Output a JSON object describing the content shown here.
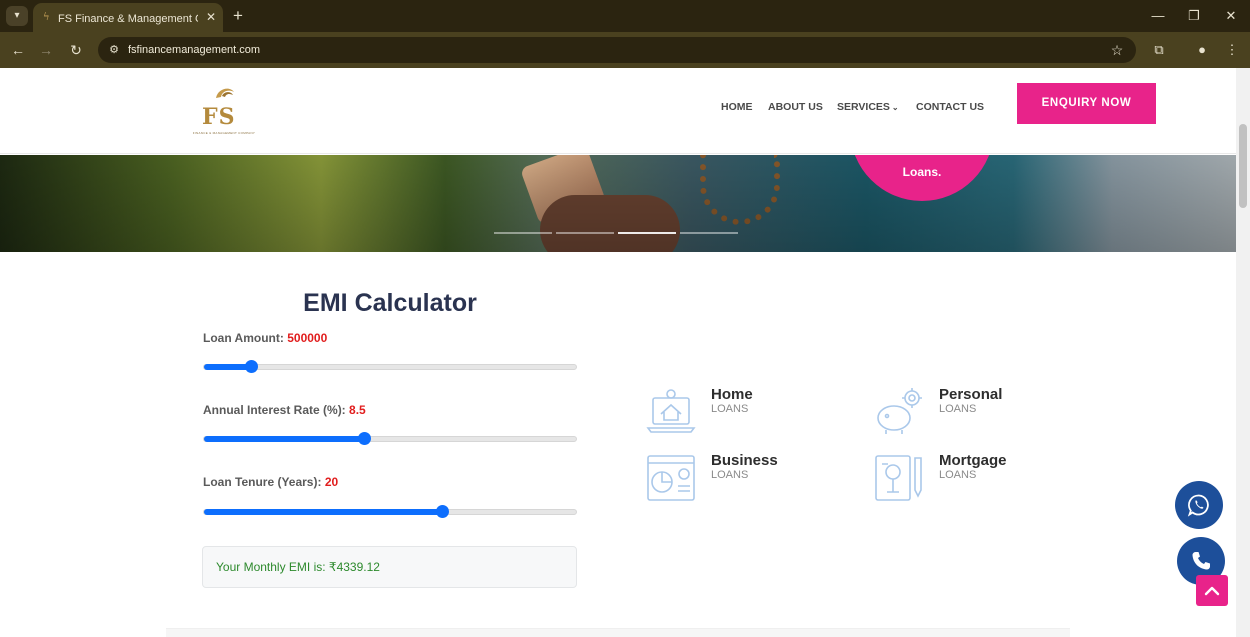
{
  "browser": {
    "tab_title": "FS Finance & Management Com",
    "url": "fsfinancemanagement.com"
  },
  "header": {
    "logo_text": "FS",
    "logo_subtext": "FINANCE & MANAGEMENT COMPANY",
    "nav": [
      {
        "label": "HOME"
      },
      {
        "label": "ABOUT US"
      },
      {
        "label": "SERVICES",
        "has_dropdown": true
      },
      {
        "label": "CONTACT US"
      }
    ],
    "cta_label": "ENQUIRY NOW"
  },
  "hero": {
    "circle_text": "Loans.",
    "slides": 4,
    "active_slide": 3
  },
  "emi": {
    "title": "EMI Calculator",
    "loan_amount": {
      "label": "Loan Amount:",
      "value": "500000",
      "fraction": 0.125
    },
    "interest_rate": {
      "label": "Annual Interest Rate (%):",
      "value": "8.5",
      "fraction": 0.43
    },
    "tenure": {
      "label": "Loan Tenure (Years):",
      "value": "20",
      "fraction": 0.64
    },
    "result_text": "Your Monthly EMI is: ₹4339.12"
  },
  "loans": [
    {
      "title": "Home",
      "subtitle": "LOANS",
      "icon": "laptop-house-icon"
    },
    {
      "title": "Personal",
      "subtitle": "LOANS",
      "icon": "piggy-bank-icon"
    },
    {
      "title": "Business",
      "subtitle": "LOANS",
      "icon": "chart-report-icon"
    },
    {
      "title": "Mortgage",
      "subtitle": "LOANS",
      "icon": "document-pen-icon"
    }
  ],
  "colors": {
    "accent": "#e8238a",
    "slider": "#0d6efd",
    "value_red": "#e11d1d",
    "result_green": "#2d8a2d",
    "fab_blue": "#1d4f9a",
    "chrome_dark": "#2b2410",
    "chrome_toolbar": "#4a411f"
  }
}
